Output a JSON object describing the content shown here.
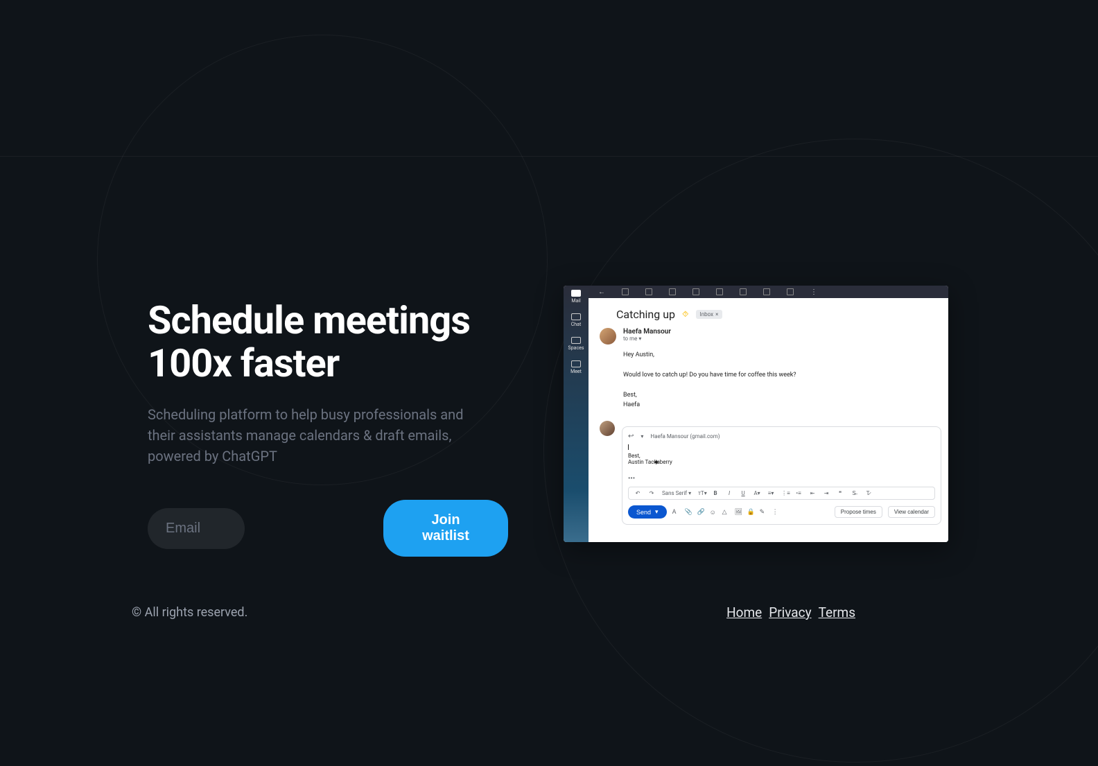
{
  "hero": {
    "title": "Schedule meetings 100x faster",
    "subtitle": "Scheduling platform to help busy professionals and their assistants manage calendars & draft emails, powered by ChatGPT",
    "email_placeholder": "Email",
    "join_label": "Join waitlist"
  },
  "gmail": {
    "sidebar": {
      "mail": "Mail",
      "chat": "Chat",
      "spaces": "Spaces",
      "meet": "Meet"
    },
    "subject": "Catching up",
    "inbox_label": "Inbox",
    "sender_name": "Haefa Mansour",
    "sender_to": "to me",
    "body_greeting": "Hey Austin,",
    "body_line": "Would love to catch up! Do you have time for coffee this week?",
    "body_signoff": "Best,",
    "body_signature": "Haefa",
    "reply_to": "Haefa Mansour (gmail.com)",
    "reply_signoff": "Best,",
    "reply_signature": "Austin Tackaberry",
    "font_name": "Sans Serif",
    "send_label": "Send",
    "propose_label": "Propose times",
    "view_cal_label": "View calendar"
  },
  "footer": {
    "copyright": "© All rights reserved.",
    "links": {
      "home": "Home",
      "privacy": "Privacy",
      "terms": "Terms"
    }
  }
}
